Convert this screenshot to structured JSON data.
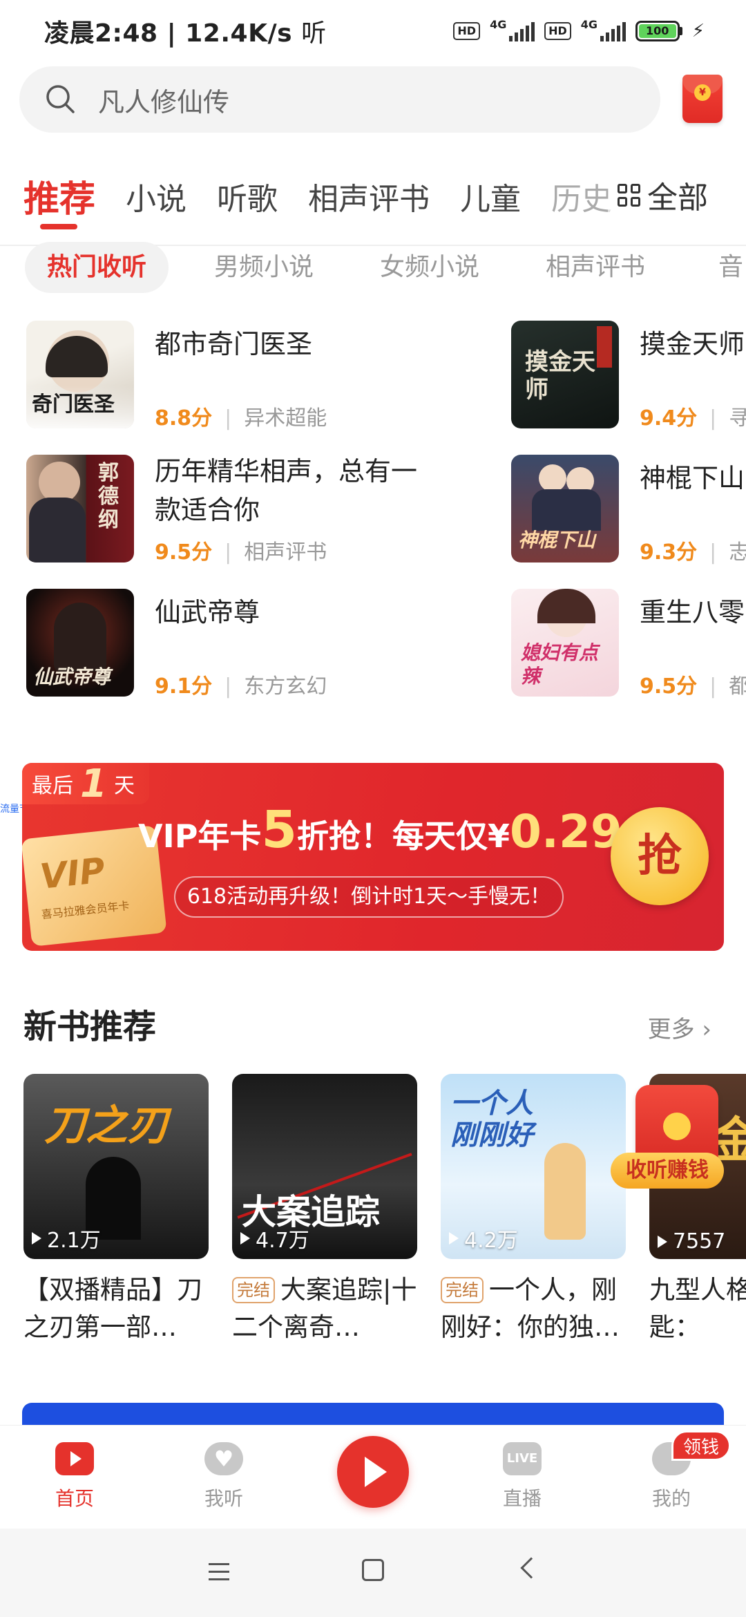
{
  "status_bar": {
    "time_speed": "凌晨2:48 | 12.4K/s",
    "hearing_glyph": "听",
    "hd1": "HD",
    "net1": "4G",
    "hd2": "HD",
    "net2": "4G",
    "battery": "100"
  },
  "search": {
    "placeholder": "凡人修仙传",
    "icon": "search-icon"
  },
  "top_tabs": [
    {
      "label": "推荐",
      "active": true
    },
    {
      "label": "小说"
    },
    {
      "label": "听歌"
    },
    {
      "label": "相声评书"
    },
    {
      "label": "儿童"
    },
    {
      "label": "历史"
    }
  ],
  "all_tab": "全部",
  "sub_tabs": [
    {
      "label": "热门收听",
      "active": true
    },
    {
      "label": "男频小说"
    },
    {
      "label": "女频小说"
    },
    {
      "label": "相声评书"
    },
    {
      "label": "音"
    }
  ],
  "hot_books": [
    {
      "title": "都市奇门医圣",
      "score": "8.8分",
      "category": "异术超能",
      "cover_text": "奇门医圣"
    },
    {
      "title": "摸金天师",
      "score": "9.4分",
      "category": "寻",
      "cover_text": "摸金天师"
    },
    {
      "title": "历年精华相声，总有一款适合你",
      "score": "9.5分",
      "category": "相声评书",
      "cover_text": "郭德纲"
    },
    {
      "title": "神棍下山",
      "score": "9.3分",
      "category": "志",
      "cover_text": "神棍下山"
    },
    {
      "title": "仙武帝尊",
      "score": "9.1分",
      "category": "东方玄幻",
      "cover_text": "仙武帝尊"
    },
    {
      "title": "重生八零",
      "score": "9.5分",
      "category": "都",
      "cover_text": "媳妇有点辣"
    }
  ],
  "banner": {
    "tag_pre": "最后",
    "tag_num": "1",
    "tag_post": "天",
    "vip_text": "VIP",
    "vip_sub": "喜马拉雅会员年卡",
    "main_pre": "VIP年卡",
    "main_big": "5",
    "main_mid": "折抢！每天仅¥",
    "main_price": "0.29",
    "sub": "618活动再升级！倒计时1天～手慢无！",
    "button": "抢",
    "side_label": "流量节包"
  },
  "new_books": {
    "title": "新书推荐",
    "more": "更多",
    "items": [
      {
        "title": "【双播精品】刀之刃第一部…",
        "plays": "2.1万",
        "done": "",
        "cover_text": "刀之刃"
      },
      {
        "title": "大案追踪|十二个离奇…",
        "plays": "4.7万",
        "done": "完结",
        "cover_text": "大案追踪"
      },
      {
        "title": "一个人，刚刚好：你的独…",
        "plays": "4.2万",
        "done": "完结",
        "cover_text": "一个人刚刚好"
      },
      {
        "title": "九型人格金钥匙：",
        "plays": "7557",
        "done": "",
        "cover_text": "金"
      }
    ]
  },
  "float_redpack": {
    "label": "收听赚钱"
  },
  "bottom_nav": {
    "home": "首页",
    "listen": "我听",
    "live": "直播",
    "live_icon": "LIVE",
    "me": "我的",
    "earn_badge": "领钱"
  },
  "colors": {
    "accent": "#e5322c",
    "score": "#f08a1c"
  }
}
